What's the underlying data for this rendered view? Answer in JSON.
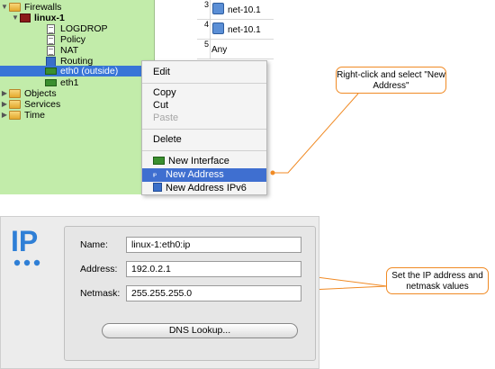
{
  "tree": {
    "items": [
      {
        "label": "Firewalls",
        "icon": "folder-icon"
      },
      {
        "label": "linux-1",
        "icon": "firewall-icon"
      },
      {
        "label": "LOGDROP",
        "icon": "policy-doc-icon"
      },
      {
        "label": "Policy",
        "icon": "policy-doc-icon"
      },
      {
        "label": "NAT",
        "icon": "policy-doc-icon"
      },
      {
        "label": "Routing",
        "icon": "routing-icon"
      },
      {
        "label": "eth0 (outside)",
        "icon": "interface-icon"
      },
      {
        "label": "eth1",
        "icon": "interface-icon"
      },
      {
        "label": "Objects",
        "icon": "folder-icon"
      },
      {
        "label": "Services",
        "icon": "folder-icon"
      },
      {
        "label": "Time",
        "icon": "folder-icon"
      }
    ]
  },
  "rules": {
    "rows": [
      {
        "num": "3",
        "text": "net-10.1"
      },
      {
        "num": "4",
        "text": "net-10.1"
      },
      {
        "num": "5",
        "text": "Any"
      }
    ]
  },
  "context_menu": {
    "edit": "Edit",
    "copy": "Copy",
    "cut": "Cut",
    "paste": "Paste",
    "delete": "Delete",
    "new_interface": "New Interface",
    "new_address": "New Address",
    "new_address_ipv6": "New Address IPv6"
  },
  "callouts": {
    "menu_hint": "Right-click and select \"New Address\"",
    "fields_hint": "Set the IP address and netmask values"
  },
  "dialog": {
    "logo": "IP",
    "name_label": "Name:",
    "name_value": "linux-1:eth0:ip",
    "address_label": "Address:",
    "address_value": "192.0.2.1",
    "netmask_label": "Netmask:",
    "netmask_value": "255.255.255.0",
    "dns_button": "DNS Lookup..."
  },
  "colors": {
    "tree_bg": "#c2ecaa",
    "selection": "#3875d7",
    "callout_line": "#f08a24",
    "logo_blue": "#2f7fd6"
  }
}
